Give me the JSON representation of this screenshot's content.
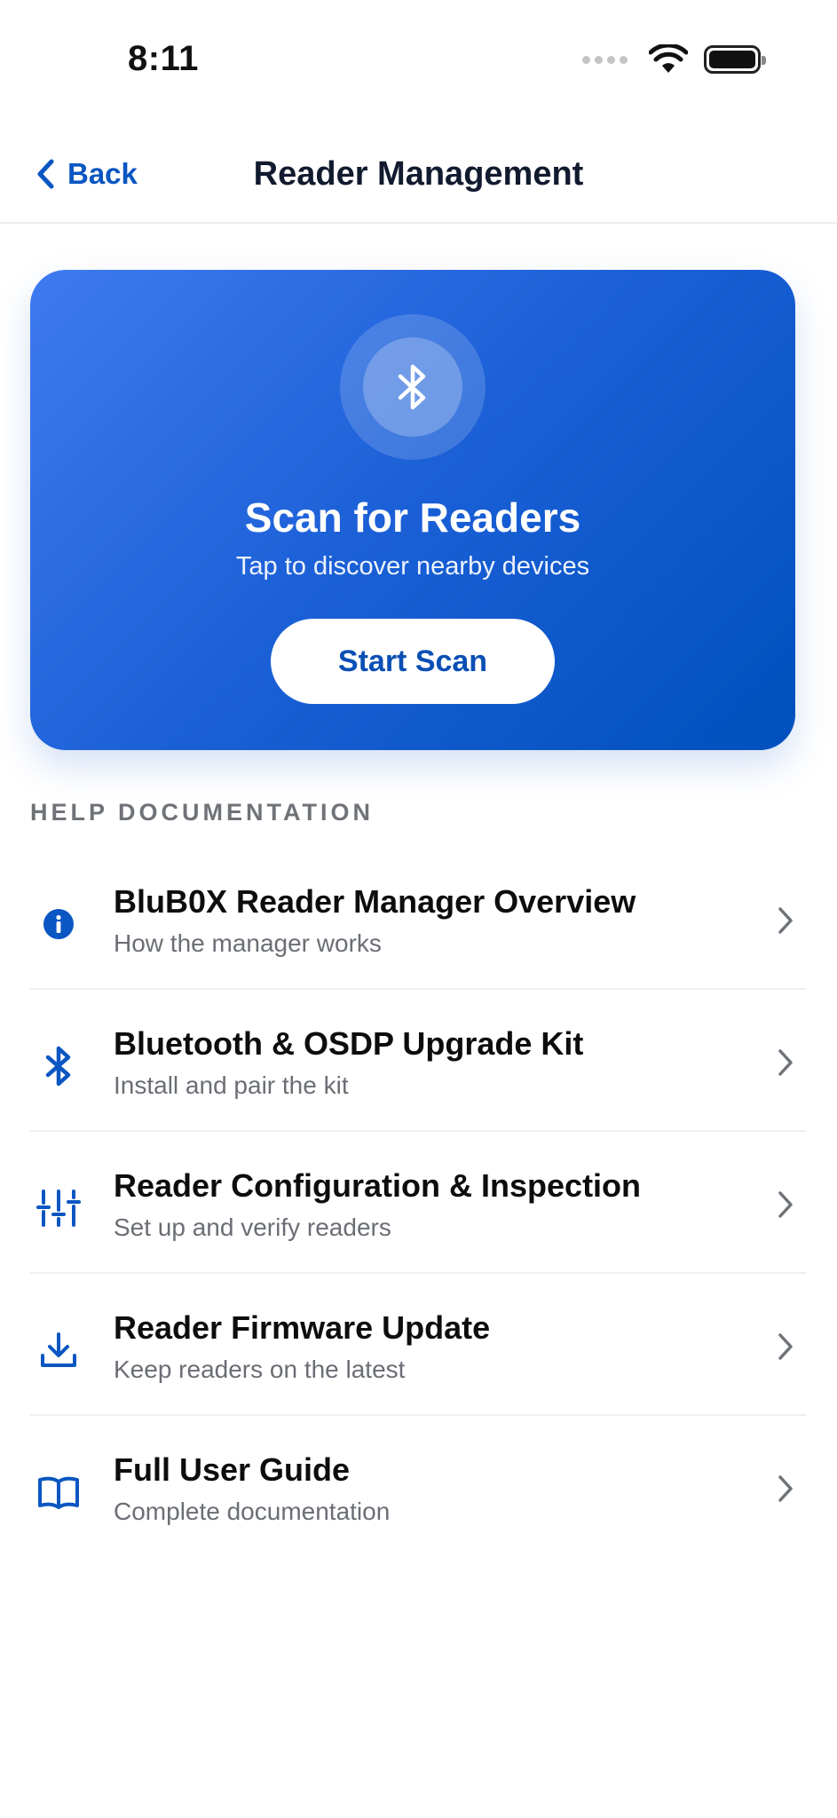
{
  "status_bar": {
    "time": "8:11",
    "icons": [
      "signal-dots-icon",
      "wifi-icon",
      "battery-icon"
    ]
  },
  "nav": {
    "back_label": "Back",
    "title": "Reader Management"
  },
  "scan_card": {
    "icon": "bluetooth-icon",
    "title": "Scan for Readers",
    "subtitle": "Tap to discover nearby devices",
    "button_label": "Start Scan",
    "gradient": [
      "#3e7af0",
      "#0050bd"
    ]
  },
  "help": {
    "header": "HELP DOCUMENTATION",
    "items": [
      {
        "icon": "info-icon",
        "title": "BluB0X Reader Manager Overview",
        "subtitle": "How the manager works"
      },
      {
        "icon": "bluetooth-icon",
        "title": "Bluetooth & OSDP Upgrade Kit",
        "subtitle": "Install and pair the kit"
      },
      {
        "icon": "sliders-icon",
        "title": "Reader Configuration & Inspection",
        "subtitle": "Set up and verify readers"
      },
      {
        "icon": "download-icon",
        "title": "Reader Firmware Update",
        "subtitle": "Keep readers on the latest"
      },
      {
        "icon": "book-icon",
        "title": "Full User Guide",
        "subtitle": "Complete documentation"
      }
    ]
  },
  "colors": {
    "accent": "#0a56c2",
    "chevron": "#6f7378",
    "divider": "#efeff1"
  }
}
